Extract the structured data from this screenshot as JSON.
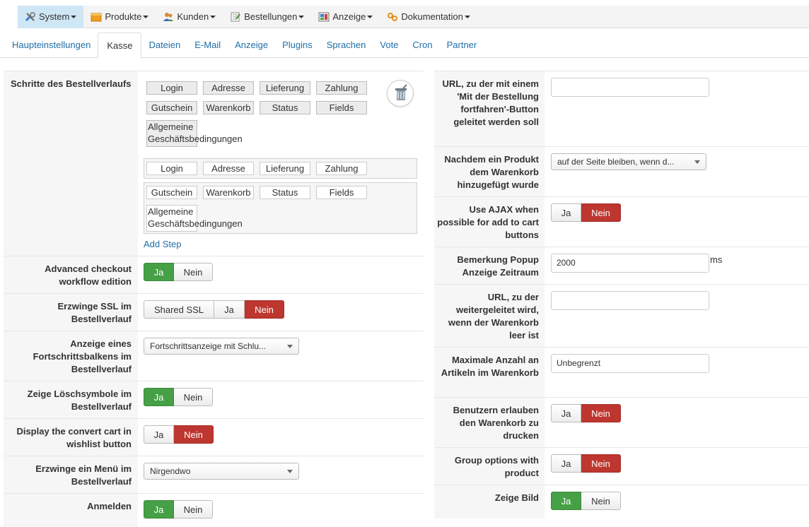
{
  "menu": [
    {
      "label": "System",
      "icon": "wrench-icon",
      "active": true
    },
    {
      "label": "Produkte",
      "icon": "box-icon"
    },
    {
      "label": "Kunden",
      "icon": "users-icon"
    },
    {
      "label": "Bestellungen",
      "icon": "orders-icon"
    },
    {
      "label": "Anzeige",
      "icon": "display-icon"
    },
    {
      "label": "Dokumentation",
      "icon": "gears-icon"
    }
  ],
  "tabs": [
    "Haupteinstellungen",
    "Kasse",
    "Dateien",
    "E-Mail",
    "Anzeige",
    "Plugins",
    "Sprachen",
    "Vote",
    "Cron",
    "Partner"
  ],
  "active_tab": "Kasse",
  "left": {
    "steps_label": "Schritte des Bestellverlaufs",
    "palette": [
      "Login",
      "Adresse",
      "Lieferung",
      "Zahlung",
      "Gutschein",
      "Warenkorb",
      "Status",
      "Fields"
    ],
    "palette_multi": [
      "Allgemeine",
      "Geschäftsbedingungen"
    ],
    "zone1": [
      "Login",
      "Adresse",
      "Lieferung",
      "Zahlung"
    ],
    "zone2": [
      "Gutschein",
      "Warenkorb",
      "Status",
      "Fields"
    ],
    "zone2_multi": [
      "Allgemeine",
      "Geschäftsbedingungen"
    ],
    "add_step": "Add Step",
    "advanced_label": "Advanced checkout workflow edition",
    "ssl_label": "Erzwinge SSL im Bestellverlauf",
    "ssl_shared": "Shared SSL",
    "progress_label": "Anzeige eines Fortschrittsbalkens im Bestellverlauf",
    "progress_value": "Fortschrittsanzeige mit Schlu...",
    "delete_label": "Zeige Löschsymbole im Bestellverlauf",
    "wishlist_label": "Display the convert cart in wishlist button",
    "menu_label": "Erzwinge ein Menü im Bestellverlauf",
    "menu_value": "Nirgendwo",
    "login_label": "Anmelden"
  },
  "right": {
    "url_continue_label": "URL, zu der mit einem 'Mit der Bestellung fortfahren'-Button geleitet werden soll",
    "after_add_label": "Nachdem ein Produkt dem Warenkorb hinzugefügt wurde",
    "after_add_value": "auf der Seite bleiben, wenn d...",
    "ajax_label": "Use AJAX when possible for add to cart buttons",
    "popup_label": "Bemerkung Popup Anzeige Zeitraum",
    "popup_value": "2000",
    "popup_unit": "ms",
    "empty_url_label": "URL, zu der weitergeleitet wird, wenn der Warenkorb leer ist",
    "max_label": "Maximale Anzahl an Artikeln im Warenkorb",
    "max_value": "Unbegrenzt",
    "print_label": "Benutzern erlauben den Warenkorb zu drucken",
    "group_label": "Group options with product",
    "image_label": "Zeige Bild"
  },
  "yes": "Ja",
  "no": "Nein",
  "colors": {
    "green": "#46a046",
    "red": "#bd362f",
    "link": "#1f6fa9",
    "menu_active": "#cfe6f5"
  }
}
